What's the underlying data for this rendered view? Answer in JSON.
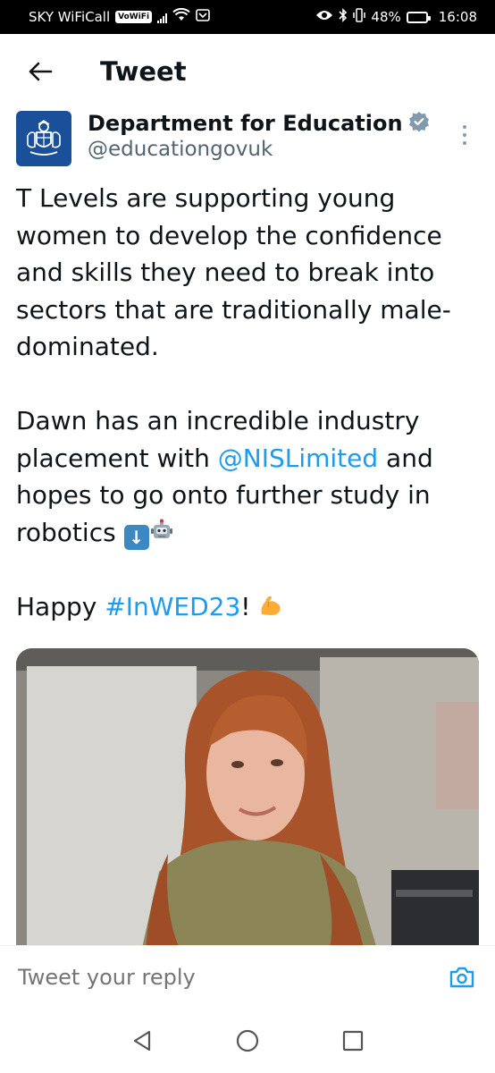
{
  "status_bar": {
    "carrier": "SKY WiFiCall",
    "vowifi": "VoWiFi",
    "battery": "48%",
    "battery_level": 0.48,
    "time": "16:08",
    "icons": [
      "signal-icon",
      "wifi-icon",
      "eye-icon",
      "bluetooth-icon",
      "vibrate-icon",
      "battery-icon"
    ]
  },
  "header": {
    "title": "Tweet",
    "back_icon": "arrow-left-icon"
  },
  "tweet": {
    "author_name": "Department for Education",
    "author_handle": "@educationgovuk",
    "verified": true,
    "paragraph1": "T Levels are supporting young women to develop the confidence and skills they need to break into sectors that are traditionally male-dominated.",
    "p2_part1": "Dawn has an incredible industry placement with ",
    "p2_mention": "@NISLimited",
    "p2_part2": " and hopes to go onto further study in robotics ",
    "p3_part1": "Happy ",
    "p3_hashtag": "#InWED23",
    "p3_part2": "! ",
    "emojis": [
      "down-arrow-emoji",
      "robot-emoji",
      "flexed-biceps-emoji"
    ]
  },
  "colors": {
    "accent": "#1d9bf0",
    "text": "#0f1419",
    "secondary_text": "#536471",
    "avatar_bg": "#1a4f9a"
  },
  "reply": {
    "placeholder": "Tweet your reply",
    "camera_icon": "camera-icon"
  },
  "nav": {
    "icons": [
      "back-triangle-icon",
      "home-circle-icon",
      "recents-square-icon"
    ]
  }
}
